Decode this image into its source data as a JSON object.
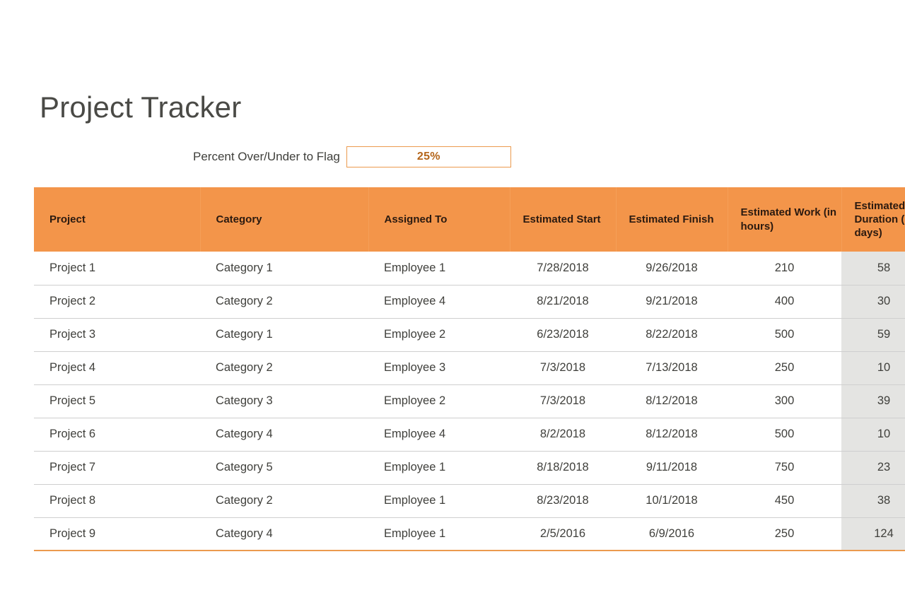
{
  "document": {
    "title": "Project Tracker"
  },
  "flag_control": {
    "label": "Percent Over/Under to Flag",
    "value": "25%",
    "placeholder": "25%",
    "border_color": "#eb9a4e",
    "value_color": "#b4651a"
  },
  "table": {
    "header_color": "#f3954a",
    "highlight_column_color": "#e4e4e2",
    "bottom_border_color": "#eb9a4e",
    "columns": [
      "Project",
      "Category",
      "Assigned To",
      "Estimated Start",
      "Estimated Finish",
      "Estimated Work (in hours)",
      "Estimated Duration (in days)"
    ],
    "rows": [
      {
        "project": "Project 1",
        "category": "Category 1",
        "assigned_to": "Employee 1",
        "estimated_start": "7/28/2018",
        "estimated_finish": "9/26/2018",
        "estimated_work_hours": "210",
        "estimated_duration_days": "58"
      },
      {
        "project": "Project 2",
        "category": "Category 2",
        "assigned_to": "Employee 4",
        "estimated_start": "8/21/2018",
        "estimated_finish": "9/21/2018",
        "estimated_work_hours": "400",
        "estimated_duration_days": "30"
      },
      {
        "project": "Project 3",
        "category": "Category 1",
        "assigned_to": "Employee 2",
        "estimated_start": "6/23/2018",
        "estimated_finish": "8/22/2018",
        "estimated_work_hours": "500",
        "estimated_duration_days": "59"
      },
      {
        "project": "Project 4",
        "category": "Category 2",
        "assigned_to": "Employee 3",
        "estimated_start": "7/3/2018",
        "estimated_finish": "7/13/2018",
        "estimated_work_hours": "250",
        "estimated_duration_days": "10"
      },
      {
        "project": "Project 5",
        "category": "Category 3",
        "assigned_to": "Employee 2",
        "estimated_start": "7/3/2018",
        "estimated_finish": "8/12/2018",
        "estimated_work_hours": "300",
        "estimated_duration_days": "39"
      },
      {
        "project": "Project 6",
        "category": "Category 4",
        "assigned_to": "Employee 4",
        "estimated_start": "8/2/2018",
        "estimated_finish": "8/12/2018",
        "estimated_work_hours": "500",
        "estimated_duration_days": "10"
      },
      {
        "project": "Project 7",
        "category": "Category 5",
        "assigned_to": "Employee 1",
        "estimated_start": "8/18/2018",
        "estimated_finish": "9/11/2018",
        "estimated_work_hours": "750",
        "estimated_duration_days": "23"
      },
      {
        "project": "Project 8",
        "category": "Category 2",
        "assigned_to": "Employee 1",
        "estimated_start": "8/23/2018",
        "estimated_finish": "10/1/2018",
        "estimated_work_hours": "450",
        "estimated_duration_days": "38"
      },
      {
        "project": "Project 9",
        "category": "Category 4",
        "assigned_to": "Employee 1",
        "estimated_start": "2/5/2016",
        "estimated_finish": "6/9/2016",
        "estimated_work_hours": "250",
        "estimated_duration_days": "124"
      }
    ]
  }
}
